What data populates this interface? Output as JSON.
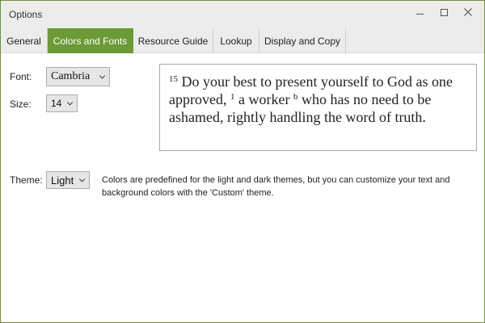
{
  "window": {
    "title": "Options"
  },
  "tabs": [
    {
      "label": "General"
    },
    {
      "label": "Colors and Fonts"
    },
    {
      "label": "Resource Guide"
    },
    {
      "label": "Lookup"
    },
    {
      "label": "Display and Copy"
    }
  ],
  "active_tab": "Colors and Fonts",
  "font": {
    "label": "Font:",
    "value": "Cambria"
  },
  "size": {
    "label": "Size:",
    "value": "14"
  },
  "theme": {
    "label": "Theme:",
    "value": "Light",
    "note": "Colors are predefined for the light and dark themes, but you can customize your text and background colors with the 'Custom' theme."
  },
  "preview": {
    "verse_number": "15",
    "text_1": "Do your best to present yourself to God as one approved,",
    "footnote_1": "1",
    "text_2": "a worker",
    "footnote_2": "b",
    "text_3": "who has no need to be ashamed, rightly handling the word of truth."
  },
  "colors": {
    "accent": "#6b9a36",
    "window_border": "#6f8f3a",
    "chrome": "#ececec"
  },
  "icons": {
    "minimize": "minimize-icon",
    "maximize": "maximize-icon",
    "close": "close-icon",
    "dropdown": "chevron-down-icon"
  }
}
